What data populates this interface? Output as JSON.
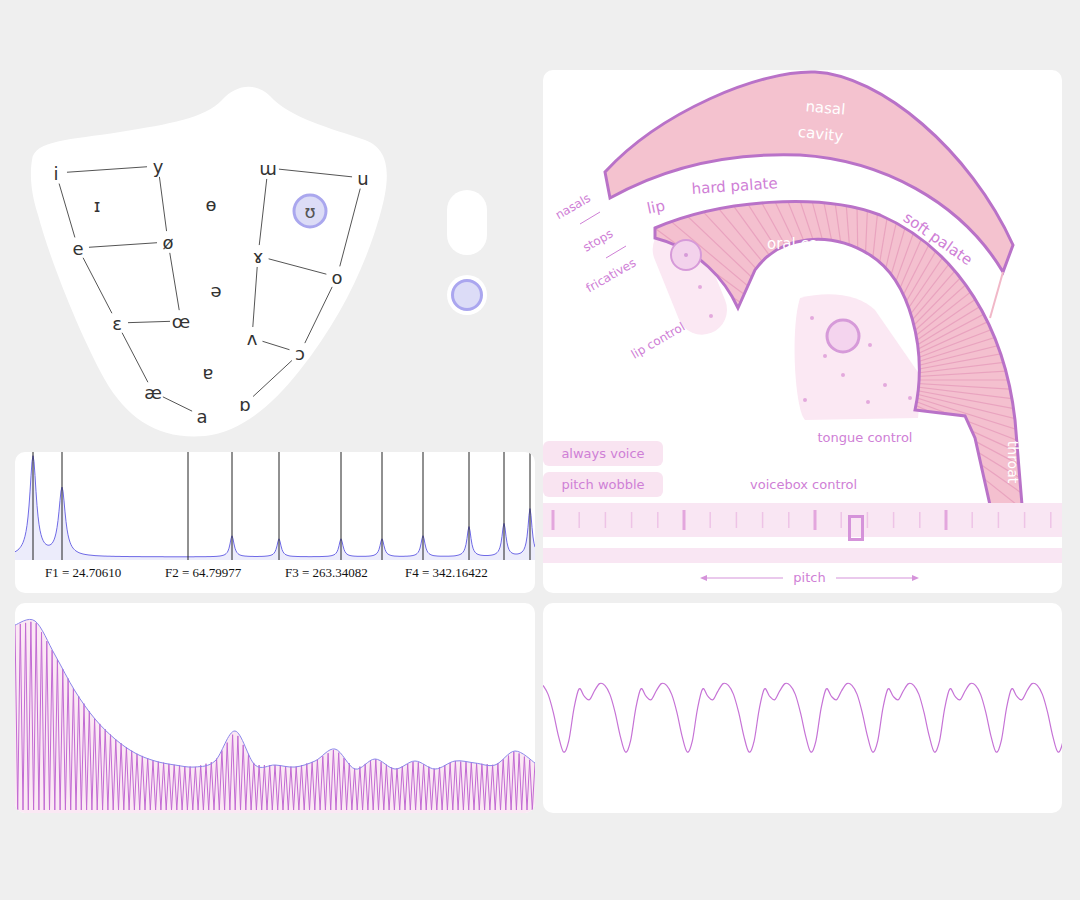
{
  "vowel_chart": {
    "vowels": [
      {
        "symbol": "i",
        "selected": false
      },
      {
        "symbol": "y",
        "selected": false
      },
      {
        "symbol": "ɯ",
        "selected": false
      },
      {
        "symbol": "u",
        "selected": false
      },
      {
        "symbol": "ɪ",
        "selected": false
      },
      {
        "symbol": "ɵ",
        "selected": false
      },
      {
        "symbol": "ʊ",
        "selected": true
      },
      {
        "symbol": "e",
        "selected": false
      },
      {
        "symbol": "ø",
        "selected": false
      },
      {
        "symbol": "ɤ",
        "selected": false
      },
      {
        "symbol": "o",
        "selected": false
      },
      {
        "symbol": "ə",
        "selected": false
      },
      {
        "symbol": "ɛ",
        "selected": false
      },
      {
        "symbol": "œ",
        "selected": false
      },
      {
        "symbol": "ʌ",
        "selected": false
      },
      {
        "symbol": "ɔ",
        "selected": false
      },
      {
        "symbol": "ɐ",
        "selected": false
      },
      {
        "symbol": "æ",
        "selected": false
      },
      {
        "symbol": "ɒ",
        "selected": false
      },
      {
        "symbol": "a",
        "selected": false
      }
    ]
  },
  "side_buttons": [
    {
      "kind": "pill",
      "on": false
    },
    {
      "kind": "dot",
      "on": true
    }
  ],
  "formant_chart": {
    "markers": [
      18,
      47,
      173,
      217,
      264,
      326,
      367,
      408,
      454,
      489,
      515
    ],
    "peaks": [
      {
        "at": 18,
        "height": 1.0
      },
      {
        "at": 47,
        "height": 0.68
      },
      {
        "at": 217,
        "height": 0.21
      },
      {
        "at": 264,
        "height": 0.18
      },
      {
        "at": 326,
        "height": 0.18
      },
      {
        "at": 367,
        "height": 0.18
      },
      {
        "at": 408,
        "height": 0.21
      },
      {
        "at": 454,
        "height": 0.3
      },
      {
        "at": 489,
        "height": 0.33
      },
      {
        "at": 515,
        "height": 0.48
      }
    ],
    "labels": [
      "F1 = 24.70610",
      "F2 = 64.79977",
      "F3 = 263.34082",
      "F4 = 342.16422"
    ]
  },
  "tract": {
    "nasal_cavity": [
      "nasal",
      "cavity"
    ],
    "hard_palate": "hard palate",
    "soft_palate": "soft palate",
    "lip": "lip",
    "oral_cavity": "oral ca",
    "throat": "throat",
    "manners": [
      "nasals",
      "stops",
      "fricatives"
    ],
    "lip_control": "lip control",
    "tongue_control": "tongue control"
  },
  "controls": {
    "toggles": [
      {
        "label": "always voice",
        "on": false
      },
      {
        "label": "pitch wobble",
        "on": false
      }
    ],
    "voicebox": {
      "label": "voicebox control",
      "level": 0.61
    },
    "pitch": {
      "label": "pitch"
    }
  },
  "spectrum": {
    "envelope": [
      93,
      95,
      78,
      60,
      46,
      36,
      29,
      25,
      23,
      22,
      25,
      40,
      23,
      23,
      22,
      25,
      31,
      21,
      26,
      21,
      25,
      21,
      25,
      24,
      23,
      30,
      24
    ],
    "harmonics": 98
  },
  "waveform": {
    "period": [
      0.85,
      0.6,
      0.1,
      -0.55,
      -1.0,
      -0.7,
      0.2,
      0.75,
      0.55,
      0.45,
      0.7,
      0.9
    ],
    "periods": 8.4
  }
}
